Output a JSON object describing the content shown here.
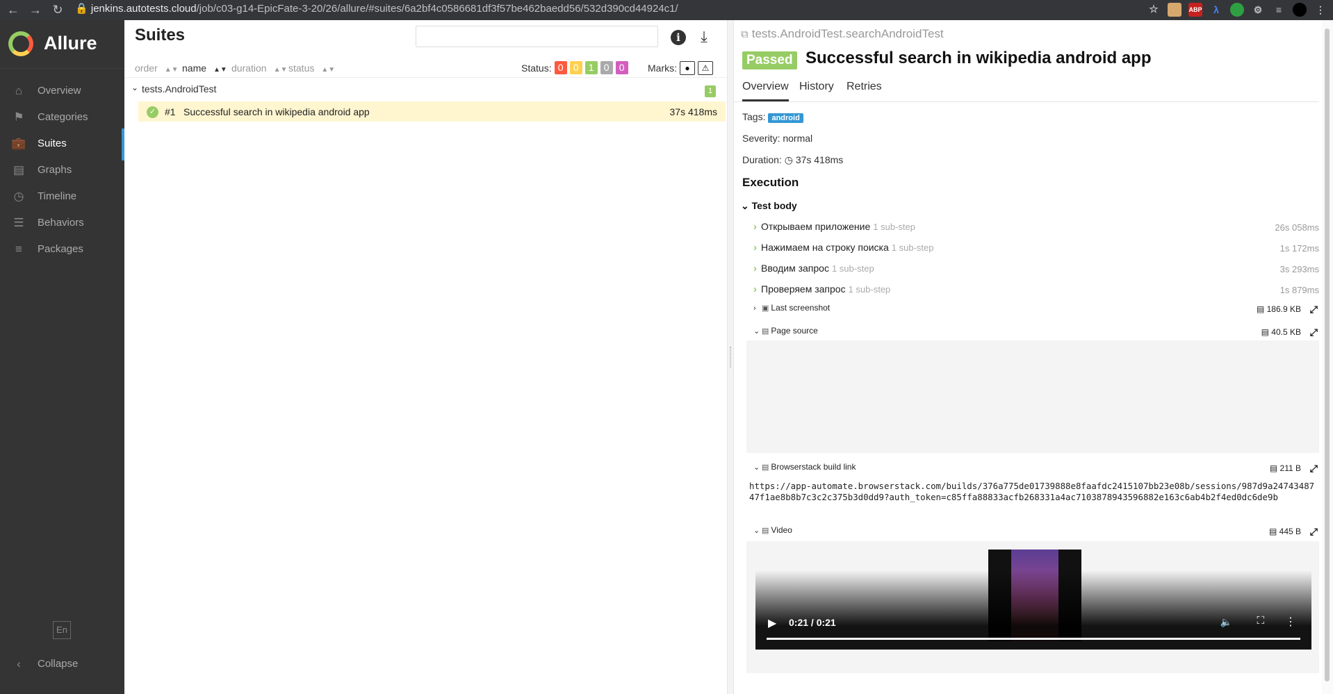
{
  "browser": {
    "url_host": "jenkins.autotests.cloud",
    "url_path": "/job/c03-g14-EpicFate-3-20/26/allure/#suites/6a2bf4c0586681df3f57be462baedd56/532d390cd44924c1/",
    "ext_abp": "ABP"
  },
  "app": {
    "name": "Allure"
  },
  "sidebar": {
    "items": [
      {
        "label": "Overview"
      },
      {
        "label": "Categories"
      },
      {
        "label": "Suites"
      },
      {
        "label": "Graphs"
      },
      {
        "label": "Timeline"
      },
      {
        "label": "Behaviors"
      },
      {
        "label": "Packages"
      }
    ],
    "lang": "En",
    "collapse": "Collapse"
  },
  "suites": {
    "title": "Suites",
    "search_placeholder": "",
    "sort": {
      "order": "order",
      "name": "name",
      "duration": "duration",
      "status": "status"
    },
    "status_label": "Status:",
    "status_counts": [
      {
        "value": "0",
        "color": "#fd5a3e"
      },
      {
        "value": "0",
        "color": "#ffd050"
      },
      {
        "value": "1",
        "color": "#97cc64"
      },
      {
        "value": "0",
        "color": "#aaaaaa"
      },
      {
        "value": "0",
        "color": "#d35ebe"
      }
    ],
    "marks_label": "Marks:",
    "group": {
      "name": "tests.AndroidTest",
      "count": "1"
    },
    "test": {
      "num": "#1",
      "name": "Successful search in wikipedia android app",
      "duration": "37s 418ms"
    }
  },
  "result": {
    "fullname": "tests.AndroidTest.searchAndroidTest",
    "status": "Passed",
    "title": "Successful search in wikipedia android app",
    "tabs": [
      "Overview",
      "History",
      "Retries"
    ],
    "tags_label": "Tags:",
    "tag": "android",
    "severity": "Severity: normal",
    "duration_label": "Duration:",
    "duration": "37s 418ms",
    "execution": "Execution",
    "test_body": "Test body",
    "steps": [
      {
        "name": "Открываем приложение",
        "sub": "1 sub-step",
        "duration": "26s 058ms"
      },
      {
        "name": "Нажимаем на строку поиска",
        "sub": "1 sub-step",
        "duration": "1s 172ms"
      },
      {
        "name": "Вводим запрос",
        "sub": "1 sub-step",
        "duration": "3s 293ms"
      },
      {
        "name": "Проверяем запрос",
        "sub": "1 sub-step",
        "duration": "1s 879ms"
      }
    ],
    "attachments": [
      {
        "name": "Last screenshot",
        "size": "186.9 KB"
      },
      {
        "name": "Page source",
        "size": "40.5 KB"
      },
      {
        "name": "Browserstack build link",
        "size": "211 B"
      },
      {
        "name": "Video",
        "size": "445 B"
      }
    ],
    "build_link": "https://app-automate.browserstack.com/builds/376a775de01739888e8faafdc2415107bb23e08b/sessions/987d9a2474348747f1ae8b8b7c3c2c375b3d0dd9?auth_token=c85ffa88833acfb268331a4ac7103878943596882e163c6ab4b2f4ed0dc6de9b",
    "video_time": "0:21 / 0:21"
  }
}
